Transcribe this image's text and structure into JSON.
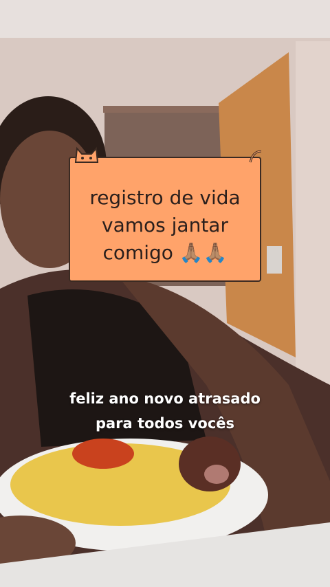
{
  "sticker": {
    "text": "registro de vida\nvamos jantar\ncomigo 🙏🏽🙏🏽",
    "background": "#ffa36a",
    "icon": "cat-icon"
  },
  "caption": {
    "line1": "feliz ano novo atrasado",
    "line2": "para todos vocês"
  }
}
